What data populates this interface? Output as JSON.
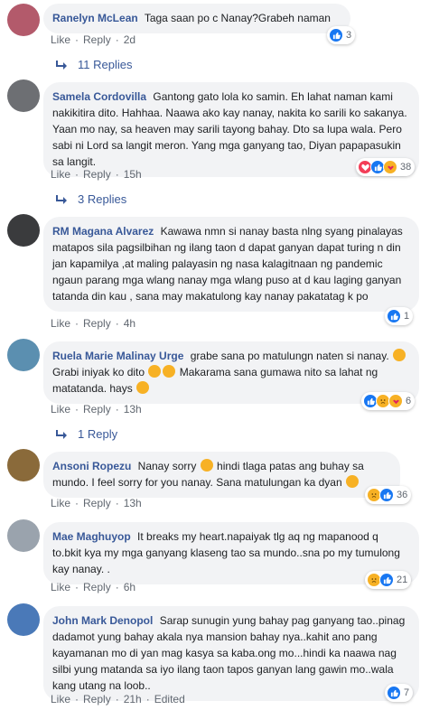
{
  "comments": [
    {
      "author": "Ranelyn McLean",
      "text": "Taga saan po c Nanay?Grabeh naman",
      "like": "Like",
      "reply": "Reply",
      "time": "2d",
      "reactions": [
        "like-icon"
      ],
      "reaction_count": "3",
      "replies": "11 Replies",
      "avatar_color": "#b35a6b"
    },
    {
      "author": "Samela Cordovilla",
      "text": "Gantong gato lola ko samin. Eh lahat naman kami nakikitira dito. Hahhaa. Naawa ako kay nanay, nakita ko sarili ko sakanya. Yaan mo nay, sa heaven may sarili tayong bahay. Dto sa lupa wala. Pero sabi ni Lord sa langit meron. Yang mga ganyang tao, Diyan papapasukin sa langit.",
      "like": "Like",
      "reply": "Reply",
      "time": "15h",
      "reactions": [
        "love-icon",
        "like-icon",
        "care-icon"
      ],
      "reaction_count": "38",
      "replies": "3 Replies",
      "avatar_color": "#6d6f73"
    },
    {
      "author": "RM Magana Alvarez",
      "text": "Kawawa nmn si nanay basta nlng syang pinalayas matapos sila pagsilbihan ng ilang taon d dapat ganyan dapat turing n din jan kapamilya ,at maling palayasin ng nasa kalagitnaan ng pandemic ngaun parang mga wlang nanay mga wlang puso at d kau laging ganyan tatanda din kau , sana may makatulong kay nanay pakatatag k po",
      "like": "Like",
      "reply": "Reply",
      "time": "4h",
      "reactions": [
        "like-icon"
      ],
      "reaction_count": "1",
      "avatar_color": "#3a3b3d"
    },
    {
      "author": "Ruela Marie Malinay Urge",
      "text_a": "grabe sana po matulungn naten si nanay.",
      "text_b": "Grabi iniyak ko dito",
      "text_c": "Makarama sana gumawa nito sa lahat ng matatanda. hays",
      "like": "Like",
      "reply": "Reply",
      "time": "13h",
      "reactions": [
        "like-icon",
        "sad-icon",
        "care-icon"
      ],
      "reaction_count": "6",
      "replies": "1 Reply",
      "avatar_color": "#5b8fb0"
    },
    {
      "author": "Ansoni Ropezu",
      "text_a": "Nanay sorry",
      "text_b": "hindi tlaga patas ang buhay sa mundo. I feel sorry for you nanay. Sana matulungan ka dyan",
      "like": "Like",
      "reply": "Reply",
      "time": "13h",
      "reactions": [
        "sad-icon",
        "like-icon"
      ],
      "reaction_count": "36",
      "avatar_color": "#8a6a3a"
    },
    {
      "author": "Mae Maghuyop",
      "text": "It breaks my heart.napaiyak tlg aq ng mapanood q to.bkit kya my mga ganyang klaseng tao sa mundo..sna po my tumulong kay nanay. .",
      "like": "Like",
      "reply": "Reply",
      "time": "6h",
      "reactions": [
        "sad-icon",
        "like-icon"
      ],
      "reaction_count": "21",
      "avatar_color": "#9aa3ad"
    },
    {
      "author": "John Mark Denopol",
      "text": "Sarap sunugin yung bahay pag ganyang tao..pinag dadamot yung bahay akala nya mansion bahay nya..kahit ano pang kayamanan mo di yan mag kasya sa kaba.ong mo...hindi ka naawa nag silbi yung matanda sa iyo ilang taon tapos ganyan lang gawin mo..wala kang utang na loob..",
      "like": "Like",
      "reply": "Reply",
      "time": "21h",
      "edited": "Edited",
      "reactions": [
        "like-icon"
      ],
      "reaction_count": "7",
      "avatar_color": "#4a79b8"
    }
  ]
}
